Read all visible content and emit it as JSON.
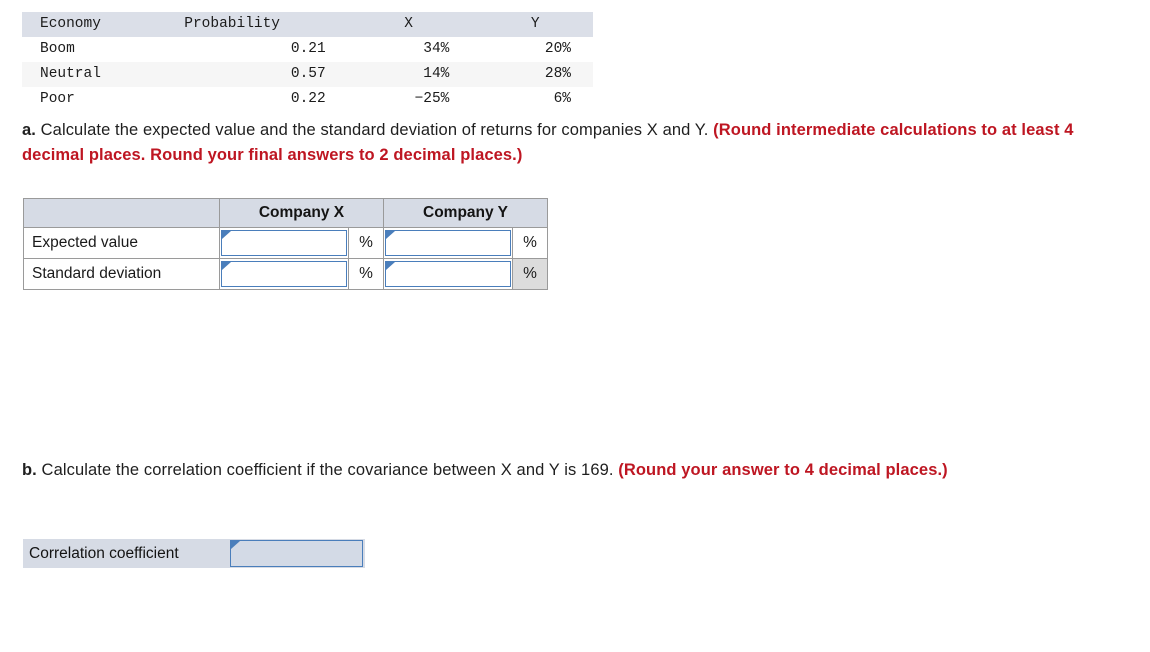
{
  "scenario_table": {
    "columns": [
      "Economy",
      "Probability",
      "X",
      "Y"
    ],
    "rows": [
      {
        "economy": "Boom",
        "probability": "0.21",
        "x": "34%",
        "y": "20%"
      },
      {
        "economy": "Neutral",
        "probability": "0.57",
        "x": "14%",
        "y": "28%"
      },
      {
        "economy": "Poor",
        "probability": "0.22",
        "x": "−25%",
        "y": "6%"
      }
    ]
  },
  "question_a": {
    "lead": "a.",
    "body": " Calculate the expected value and the standard deviation of returns for companies X and Y. ",
    "note": "(Round intermediate calculations to at least 4 decimal places. Round your final answers to 2 decimal places.)"
  },
  "answer_table": {
    "blank_header": "",
    "headers": [
      "Company X",
      "Company Y"
    ],
    "rows": [
      {
        "label": "Expected value",
        "x_value": "",
        "x_unit": "%",
        "y_value": "",
        "y_unit": "%"
      },
      {
        "label": "Standard deviation",
        "x_value": "",
        "x_unit": "%",
        "y_value": "",
        "y_unit": "%"
      }
    ]
  },
  "question_b": {
    "lead": "b.",
    "body": " Calculate the correlation coefficient if the covariance between X and Y is 169. ",
    "note": "(Round your answer to 4 decimal places.)"
  },
  "correlation": {
    "label": "Correlation coefficient",
    "value": ""
  },
  "colors": {
    "table_header_bg": "#dbdfe8",
    "stripe_bg": "#f6f6f6",
    "answer_header_bg": "#d6dbe5",
    "input_border": "#4a7ebb",
    "input_fill": "#d3dae6",
    "note_red": "#be1622",
    "shaded_cell": "#dcdcdc"
  }
}
